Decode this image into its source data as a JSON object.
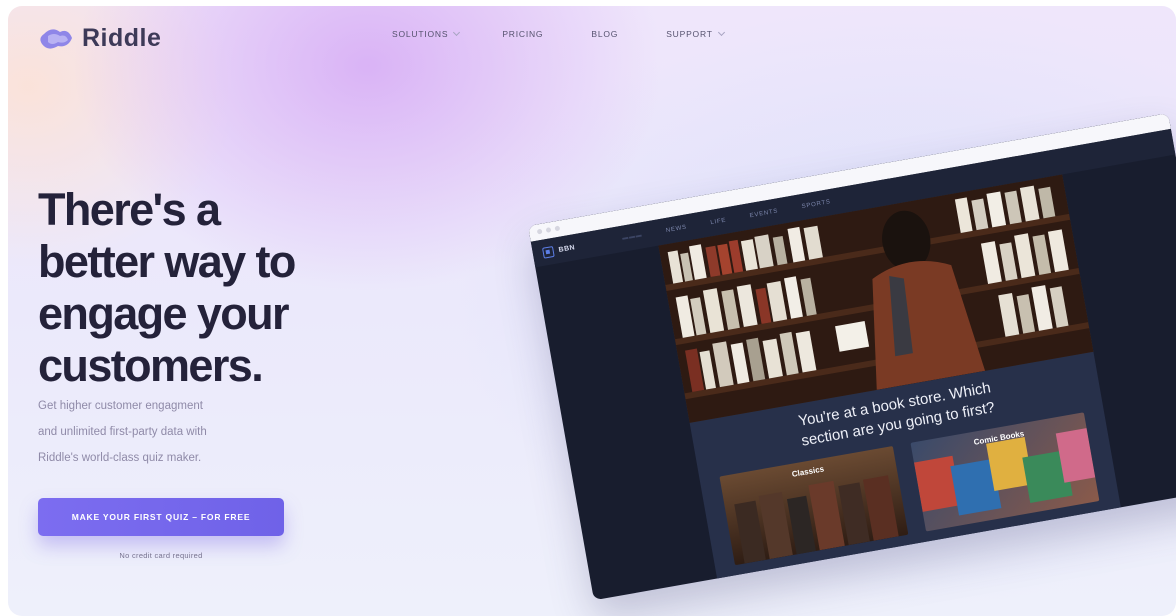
{
  "brand": {
    "name": "Riddle"
  },
  "nav": {
    "items": [
      {
        "label": "SOLUTIONS",
        "has_dropdown": true
      },
      {
        "label": "PRICING",
        "has_dropdown": false
      },
      {
        "label": "BLOG",
        "has_dropdown": false
      },
      {
        "label": "SUPPORT",
        "has_dropdown": true
      }
    ]
  },
  "hero": {
    "headline_lines": [
      "There's a",
      "better way to",
      "engage your",
      "customers."
    ],
    "subtitle_lines": [
      "Get higher customer engagment",
      "and unlimited first-party data with",
      "Riddle's world-class quiz maker."
    ],
    "cta_label": "MAKE YOUR FIRST QUIZ – FOR FREE",
    "note": "No credit card required"
  },
  "mockup": {
    "site_logo": "BBN",
    "nav_links": [
      "NEWS",
      "LIFE",
      "EVENTS",
      "SPORTS"
    ],
    "question_lines": [
      "You're at a book store. Which",
      "section are you going to first?"
    ],
    "answers": [
      {
        "label": "Classics"
      },
      {
        "label": "Comic Books"
      }
    ]
  },
  "colors": {
    "accent": "#7466ed",
    "headline": "#24223a",
    "mock_bg": "#181d2e"
  }
}
